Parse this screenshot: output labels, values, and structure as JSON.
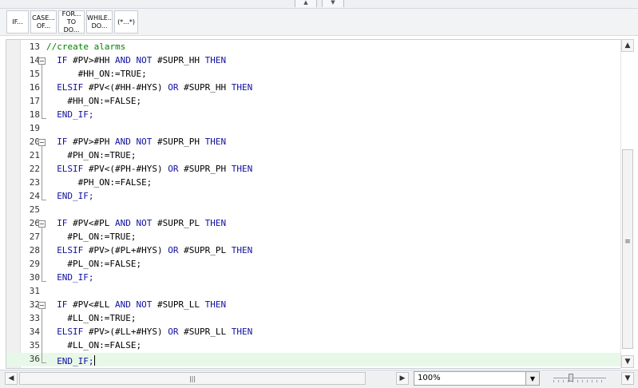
{
  "toolbar": {
    "buttons": [
      {
        "l1": "IF...",
        "l2": ""
      },
      {
        "l1": "CASE...",
        "l2": "OF..."
      },
      {
        "l1": "FOR...",
        "l2": "TO DO..."
      },
      {
        "l1": "WHILE..",
        "l2": "DO..."
      },
      {
        "l1": "(*...*)",
        "l2": ""
      }
    ]
  },
  "editor": {
    "lines": [
      {
        "n": "13",
        "fold": "none",
        "indent": 0,
        "tokens": [
          [
            "cm",
            "//create alarms"
          ]
        ]
      },
      {
        "n": "14",
        "fold": "start",
        "indent": 2,
        "tokens": [
          [
            "kw",
            "IF "
          ],
          [
            "tx",
            "#PV>#HH "
          ],
          [
            "kw",
            "AND "
          ],
          [
            "kw",
            "NOT "
          ],
          [
            "tx",
            "#SUPR_HH "
          ],
          [
            "kw",
            "THEN"
          ]
        ]
      },
      {
        "n": "15",
        "fold": "mid",
        "indent": 6,
        "tokens": [
          [
            "tx",
            "#HH_ON:=TRUE;"
          ]
        ]
      },
      {
        "n": "16",
        "fold": "mid",
        "indent": 2,
        "tokens": [
          [
            "kw",
            "ELSIF "
          ],
          [
            "tx",
            "#PV<(#HH-#HYS) "
          ],
          [
            "kw",
            "OR "
          ],
          [
            "tx",
            "#SUPR_HH "
          ],
          [
            "kw",
            "THEN"
          ]
        ]
      },
      {
        "n": "17",
        "fold": "mid",
        "indent": 4,
        "tokens": [
          [
            "tx",
            "#HH_ON:=FALSE;"
          ]
        ]
      },
      {
        "n": "18",
        "fold": "end",
        "indent": 2,
        "tokens": [
          [
            "kw",
            "END_IF;"
          ]
        ]
      },
      {
        "n": "19",
        "fold": "none",
        "indent": 0,
        "tokens": []
      },
      {
        "n": "20",
        "fold": "start",
        "indent": 2,
        "tokens": [
          [
            "kw",
            "IF "
          ],
          [
            "tx",
            "#PV>#PH "
          ],
          [
            "kw",
            "AND "
          ],
          [
            "kw",
            "NOT "
          ],
          [
            "tx",
            "#SUPR_PH "
          ],
          [
            "kw",
            "THEN"
          ]
        ]
      },
      {
        "n": "21",
        "fold": "mid",
        "indent": 4,
        "tokens": [
          [
            "tx",
            "#PH_ON:=TRUE;"
          ]
        ]
      },
      {
        "n": "22",
        "fold": "mid",
        "indent": 2,
        "tokens": [
          [
            "kw",
            "ELSIF "
          ],
          [
            "tx",
            "#PV<(#PH-#HYS) "
          ],
          [
            "kw",
            "OR "
          ],
          [
            "tx",
            "#SUPR_PH "
          ],
          [
            "kw",
            "THEN"
          ]
        ]
      },
      {
        "n": "23",
        "fold": "mid",
        "indent": 6,
        "tokens": [
          [
            "tx",
            "#PH_ON:=FALSE;"
          ]
        ]
      },
      {
        "n": "24",
        "fold": "end",
        "indent": 2,
        "tokens": [
          [
            "kw",
            "END_IF;"
          ]
        ]
      },
      {
        "n": "25",
        "fold": "none",
        "indent": 0,
        "tokens": []
      },
      {
        "n": "26",
        "fold": "start",
        "indent": 2,
        "tokens": [
          [
            "kw",
            "IF "
          ],
          [
            "tx",
            "#PV<#PL "
          ],
          [
            "kw",
            "AND "
          ],
          [
            "kw",
            "NOT "
          ],
          [
            "tx",
            "#SUPR_PL "
          ],
          [
            "kw",
            "THEN"
          ]
        ]
      },
      {
        "n": "27",
        "fold": "mid",
        "indent": 4,
        "tokens": [
          [
            "tx",
            "#PL_ON:=TRUE;"
          ]
        ]
      },
      {
        "n": "28",
        "fold": "mid",
        "indent": 2,
        "tokens": [
          [
            "kw",
            "ELSIF "
          ],
          [
            "tx",
            "#PV>(#PL+#HYS) "
          ],
          [
            "kw",
            "OR "
          ],
          [
            "tx",
            "#SUPR_PL "
          ],
          [
            "kw",
            "THEN"
          ]
        ]
      },
      {
        "n": "29",
        "fold": "mid",
        "indent": 4,
        "tokens": [
          [
            "tx",
            "#PL_ON:=FALSE;"
          ]
        ]
      },
      {
        "n": "30",
        "fold": "end",
        "indent": 2,
        "tokens": [
          [
            "kw",
            "END_IF;"
          ]
        ]
      },
      {
        "n": "31",
        "fold": "none",
        "indent": 0,
        "tokens": []
      },
      {
        "n": "32",
        "fold": "start",
        "indent": 2,
        "tokens": [
          [
            "kw",
            "IF "
          ],
          [
            "tx",
            "#PV<#LL "
          ],
          [
            "kw",
            "AND "
          ],
          [
            "kw",
            "NOT "
          ],
          [
            "tx",
            "#SUPR_LL "
          ],
          [
            "kw",
            "THEN"
          ]
        ]
      },
      {
        "n": "33",
        "fold": "mid",
        "indent": 4,
        "tokens": [
          [
            "tx",
            "#LL_ON:=TRUE;"
          ]
        ]
      },
      {
        "n": "34",
        "fold": "mid",
        "indent": 2,
        "tokens": [
          [
            "kw",
            "ELSIF "
          ],
          [
            "tx",
            "#PV>(#LL+#HYS) "
          ],
          [
            "kw",
            "OR "
          ],
          [
            "tx",
            "#SUPR_LL "
          ],
          [
            "kw",
            "THEN"
          ]
        ]
      },
      {
        "n": "35",
        "fold": "mid",
        "indent": 4,
        "tokens": [
          [
            "tx",
            "#LL_ON:=FALSE;"
          ]
        ]
      },
      {
        "n": "36",
        "fold": "end",
        "indent": 2,
        "tokens": [
          [
            "kw",
            "END_IF;"
          ]
        ],
        "current": true
      }
    ]
  },
  "status": {
    "zoom": "100%",
    "hscroll_grip": "|||",
    "vscroll_grip": "≡"
  }
}
